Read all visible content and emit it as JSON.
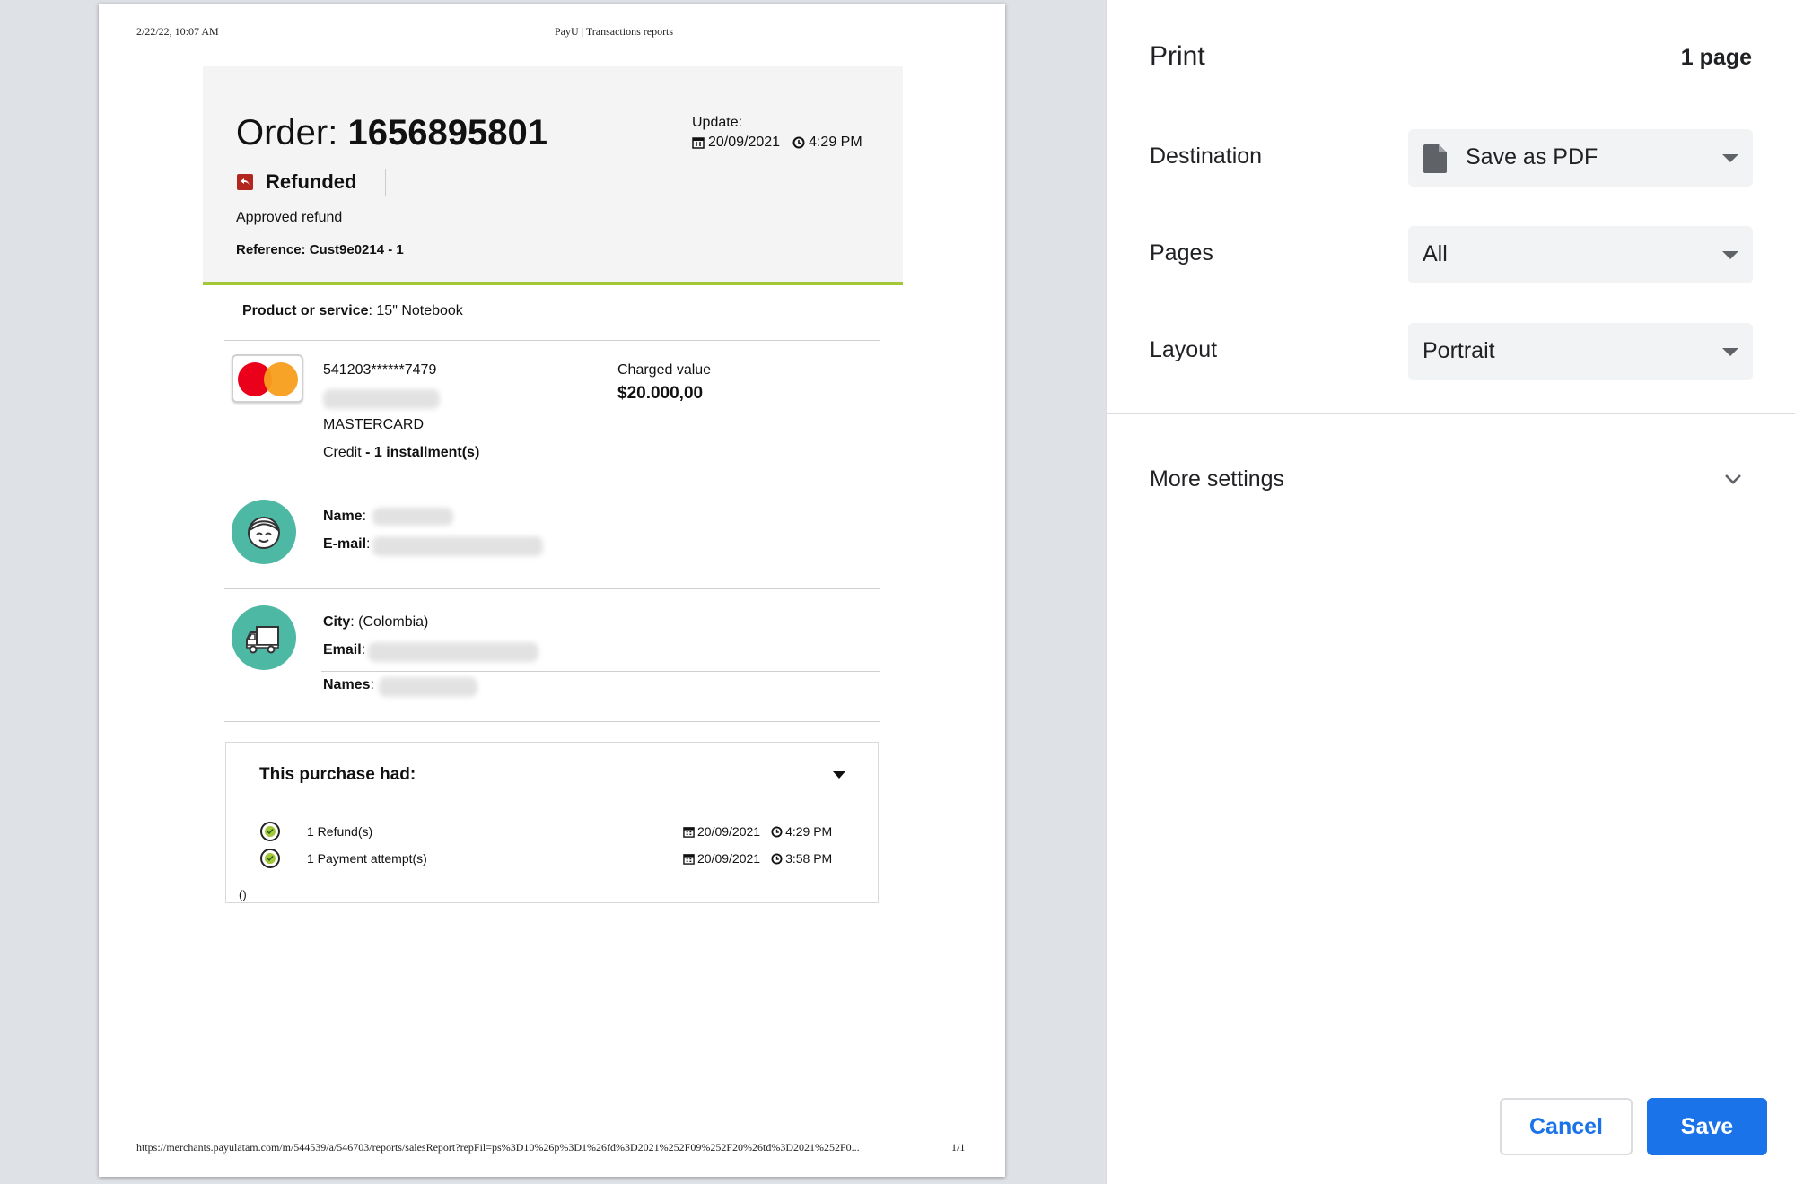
{
  "preview": {
    "header_datetime": "2/22/22, 10:07 AM",
    "header_title": "PayU | Transactions reports",
    "footer_url": "https://merchants.payulatam.com/m/544539/a/546703/reports/salesReport?repFil=ps%3D10%26p%3D1%26fd%3D2021%252F09%252F20%26td%3D2021%252F0...",
    "footer_page": "1/1",
    "order": {
      "label": "Order:",
      "number": "1656895801",
      "status": "Refunded",
      "status_detail": "Approved refund",
      "reference": "Reference: Cust9e0214 - 1",
      "update_label": "Update:",
      "update_date": "20/09/2021",
      "update_time": "4:29 PM"
    },
    "product_label": "Product or service",
    "product_value": ": 15\" Notebook",
    "payment": {
      "card_number": "541203******7479",
      "brand": "MASTERCARD",
      "credit_label": "Credit",
      "installments": " - 1 installment(s)",
      "charged_label": "Charged value",
      "charged_value": "$20.000,00"
    },
    "buyer": {
      "name_label": "Name",
      "email_label": "E-mail"
    },
    "shipping": {
      "city_label": "City",
      "city_value": ": (Colombia)",
      "email_label": "Email",
      "names_label": "Names"
    },
    "history": {
      "title": "This purchase had:",
      "rows": [
        {
          "label": "1 Refund(s)",
          "date": "20/09/2021",
          "time": "4:29 PM"
        },
        {
          "label": "1 Payment attempt(s)",
          "date": "20/09/2021",
          "time": "3:58 PM"
        }
      ],
      "trailing": "()"
    }
  },
  "print": {
    "title": "Print",
    "page_count": "1 page",
    "destination_label": "Destination",
    "destination_value": "Save as PDF",
    "pages_label": "Pages",
    "pages_value": "All",
    "layout_label": "Layout",
    "layout_value": "Portrait",
    "more_settings": "More settings",
    "cancel": "Cancel",
    "save": "Save"
  },
  "colors": {
    "accent_blue": "#1a73e8",
    "payu_green": "#a4c639",
    "refund_red": "#b3261e",
    "avatar_teal": "#4db8a4"
  }
}
